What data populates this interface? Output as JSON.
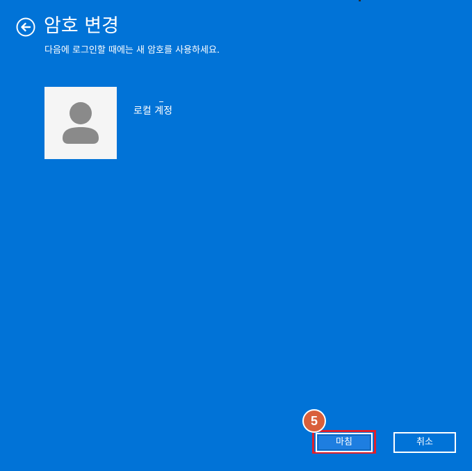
{
  "header": {
    "title": "암호 변경",
    "subtitle": "다음에 로그인할 때에는 새 암호를 사용하세요.",
    "back_icon": "back-arrow-icon"
  },
  "account": {
    "name": "로컬 계정",
    "avatar_icon": "user-avatar-icon"
  },
  "annotation": {
    "step_number": "5",
    "badge_color": "#d95f3b",
    "highlight_color": "#e0202c"
  },
  "buttons": {
    "finish_label": "마침",
    "cancel_label": "취소"
  },
  "colors": {
    "background": "#0173d7",
    "text": "#ffffff"
  }
}
